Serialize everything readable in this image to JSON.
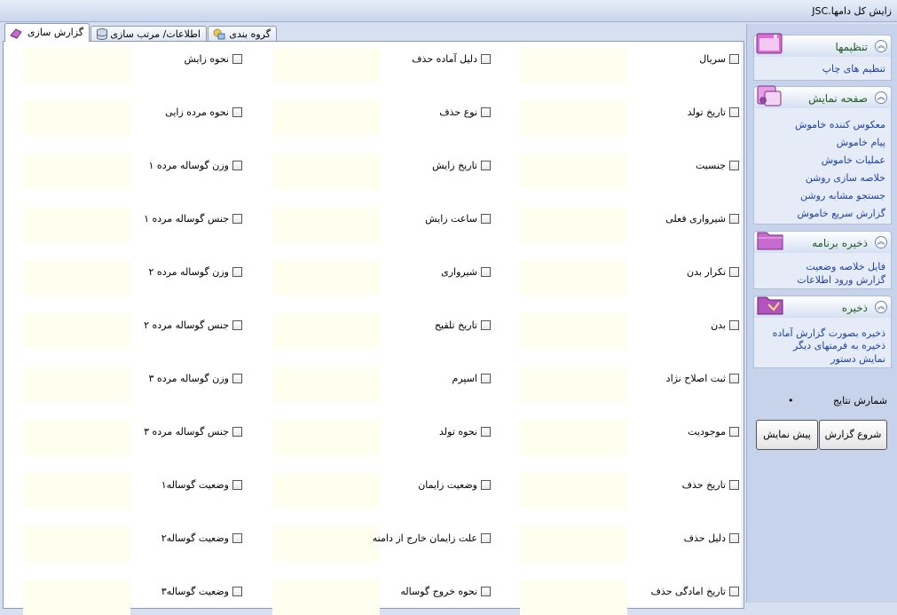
{
  "window": {
    "title": "زايش کل دامها.JSC"
  },
  "tabs": [
    {
      "label": "گزارش سازی",
      "icon": "eraser-icon"
    },
    {
      "label": "اطلاعات/ مرتب سازی",
      "icon": "database-icon"
    },
    {
      "label": "گروه بندی",
      "icon": "group-icon"
    }
  ],
  "fields": {
    "col1": [
      "سريال",
      "تاريخ تولد",
      "جنسيت",
      "شيرواری فعلی",
      "تکرار بدن",
      "بدن",
      "ثبت اصلاح نژاد",
      "موجوديت",
      "تاريخ حذف",
      "دليل حذف",
      "تاريخ امادگی حذف"
    ],
    "col2": [
      "دليل آماده حذف",
      "نوع حذف",
      "تاريخ زايش",
      "ساعت زايش",
      "شيرواری",
      "تاريخ تلقيح",
      "اسپرم",
      "نحوه تولد",
      "وضعيت زايمان",
      "علت زايمان خارج از دامنه",
      "نحوه خروج گوساله"
    ],
    "col3": [
      "نحوه زايش",
      "نحوه مرده زايی",
      "وزن گوساله مرده ۱",
      "جنس گوساله مرده ۱",
      "وزن گوساله مرده ۲",
      "جنس گوساله مرده ۲",
      "وزن گوساله مرده ۳",
      "جنس گوساله مرده ۳",
      "وضعيت گوساله۱",
      "وضعيت گوساله۲",
      "وضعيت گوساله۳"
    ]
  },
  "sidebar": {
    "groups": [
      {
        "title": "تنظيمها",
        "items": [
          "تنظيم های چاپ"
        ]
      },
      {
        "title": "صفحه نمايش",
        "items": [
          "معکوس کننده خاموش",
          "پيام خاموش",
          "عمليات خاموش",
          "خلاصه سازی روشن",
          "جستجو مشابه روشن",
          "گزارش سريع خاموش"
        ]
      },
      {
        "title": "ذخيره برنامه",
        "items": [
          "فايل خلاصه وضعيت",
          "گزارش ورود اطلاعات"
        ]
      },
      {
        "title": "ذخيره",
        "items": [
          "ذخيره بصورت گزارش آماده",
          "ذخيره به فرمتهای ديگر",
          "نمايش دستور"
        ]
      }
    ],
    "result_count_label": "شمارش نتايج",
    "result_count_value": "•",
    "buttons": {
      "start": "شروع گزارش",
      "preview": "پيش نمايش"
    }
  }
}
